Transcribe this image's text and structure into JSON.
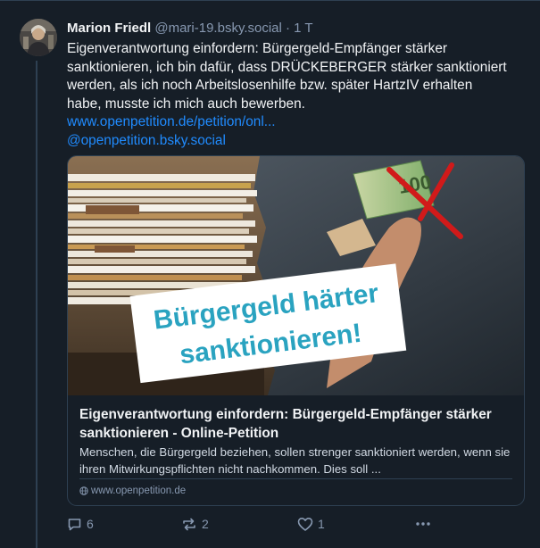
{
  "post": {
    "author_name": "Marion Friedl",
    "author_handle": "@mari-19.bsky.social · 1 T",
    "text_lines": [
      "Eigenverantwortung einfordern: Bürgergeld-Empfänger stärker",
      "sanktionieren, ich bin dafür, dass DRÜCKEBERGER stärker sanktioniert",
      "werden, als ich noch Arbeitslosenhilfe bzw. später HartzIV erhalten",
      "habe, musste ich mich auch bewerben."
    ],
    "link_url": "www.openpetition.de/petition/onl...",
    "mention": "@openpetition.bsky.social"
  },
  "card": {
    "image_text_line1": "Bürgergeld härter",
    "image_text_line2": "sanktionieren!",
    "banknote_value": "100",
    "title": "Eigenverantwortung einfordern: Bürgergeld-Empfänger stärker sanktionieren - Online-Petition",
    "description": "Menschen, die Bürgergeld beziehen, sollen strenger sanktioniert werden, wenn sie ihren Mitwirkungspflichten nicht nachkommen. Dies soll ...",
    "domain": "www.openpetition.de"
  },
  "actions": {
    "replies": "6",
    "reposts": "2",
    "likes": "1"
  },
  "colors": {
    "background": "#161e27",
    "link": "#208bfe",
    "muted": "#8798b0",
    "border": "#2e4052"
  }
}
